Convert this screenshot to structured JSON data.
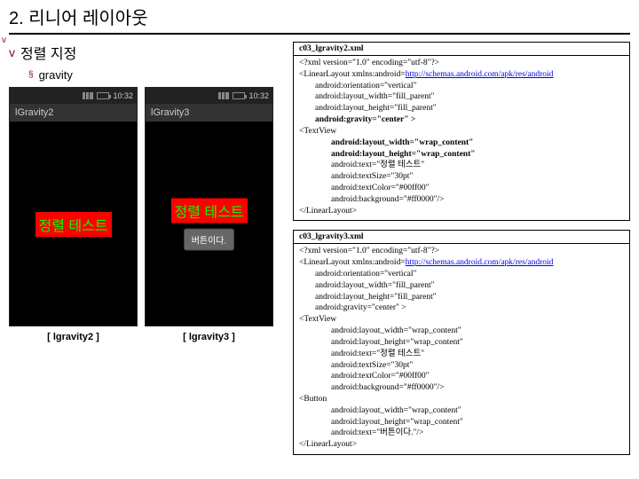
{
  "page_title": "2. 리니어 레이아웃",
  "heading": {
    "bullet": "v",
    "text": "정렬 지정"
  },
  "sub": {
    "bullet": "§",
    "text": "gravity"
  },
  "marker": "v",
  "phone1": {
    "time": "10:32",
    "appbar": "lGravity2",
    "label": "정렬 테스트"
  },
  "phone2": {
    "time": "10:32",
    "appbar": "lGravity3",
    "label": "정렬 테스트",
    "button": "버튼이다."
  },
  "caption1": "[ lgravity2 ]",
  "caption2": "[ lgravity3 ]",
  "code1": {
    "title": "c03_lgravity2.xml",
    "l0": "<?xml version=\"1.0\" encoding=\"utf-8\"?>",
    "l1a": "<LinearLayout xmlns:android=",
    "l1b": "http://schemas.android.com/apk/res/android",
    "l2": "android:orientation=\"vertical\"",
    "l3": "android:layout_width=\"fill_parent\"",
    "l4": "android:layout_height=\"fill_parent\"",
    "l5": "android:gravity=\"center\" >",
    "l6": "<TextView",
    "l7": "android:layout_width=\"wrap_content\"",
    "l8": "android:layout_height=\"wrap_content\"",
    "l9": "android:text=\"정렬 테스트\"",
    "l10": "android:textSize=\"30pt\"",
    "l11": "android:textColor=\"#00ff00\"",
    "l12": "android:background=\"#ff0000\"/>",
    "l13": "</LinearLayout>"
  },
  "code2": {
    "title": "c03_lgravity3.xml",
    "l0": "<?xml version=\"1.0\" encoding=\"utf-8\"?>",
    "l1a": "<LinearLayout xmlns:android=",
    "l1b": "http://schemas.android.com/apk/res/android",
    "l2": "android:orientation=\"vertical\"",
    "l3": "android:layout_width=\"fill_parent\"",
    "l4": "android:layout_height=\"fill_parent\"",
    "l5": "android:gravity=\"center\" >",
    "l6": "<TextView",
    "l7": "android:layout_width=\"wrap_content\"",
    "l8": "android:layout_height=\"wrap_content\"",
    "l9": "android:text=\"정렬 테스트\"",
    "l10": "android:textSize=\"30pt\"",
    "l11": "android:textColor=\"#00ff00\"",
    "l12": "android:background=\"#ff0000\"/>",
    "l13": "<Button",
    "l14": "android:layout_width=\"wrap_content\"",
    "l15": "android:layout_height=\"wrap_content\"",
    "l16": "android:text=\"버튼이다.\"/>",
    "l17": "</LinearLayout>"
  }
}
